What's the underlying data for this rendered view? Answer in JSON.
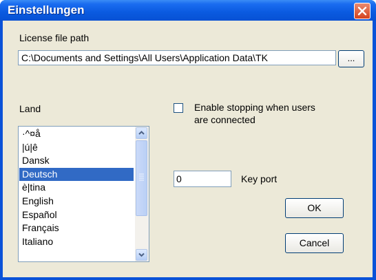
{
  "window": {
    "title": "Einstellungen",
    "close_icon": "close-icon"
  },
  "license": {
    "label": "License file path",
    "value": "C:\\Documents and Settings\\All Users\\Application Data\\TK",
    "browse_label": "..."
  },
  "land": {
    "label": "Land",
    "items": [
      "·^¤å",
      "|ú|ê",
      "Dansk",
      "Deutsch",
      "è|tina",
      "English",
      "Español",
      "Français",
      "Italiano"
    ],
    "selected": "Deutsch"
  },
  "options": {
    "enable_stopping_line1": "Enable stopping when users",
    "enable_stopping_line2": "are connected",
    "enable_stopping_checked": false
  },
  "port": {
    "value": "0",
    "label": "Key port"
  },
  "buttons": {
    "ok": "OK",
    "cancel": "Cancel"
  },
  "colors": {
    "titlebar": "#0a5ae0",
    "dialog_bg": "#ece9d8",
    "selection": "#316ac5",
    "close_button": "#d5431e"
  }
}
